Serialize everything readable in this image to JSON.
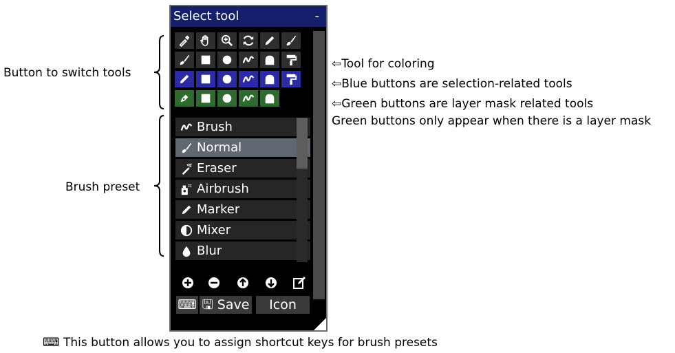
{
  "panel": {
    "title": "Select tool",
    "minimize": "-"
  },
  "annotations": {
    "switch_tools": "Button to switch tools",
    "brush_preset": "Brush preset",
    "coloring": "Tool for coloring",
    "blue": "Blue buttons are selection-related tools",
    "green": "Green buttons are layer mask related tools",
    "green_note": "Green buttons only appear when there is a layer mask",
    "shortcut": "This button allows you to assign shortcut keys for brush presets"
  },
  "presets": {
    "header": "Brush",
    "items": [
      "Normal",
      "Eraser",
      "Airbrush",
      "Marker",
      "Mixer",
      "Blur"
    ],
    "selected": "Normal"
  },
  "buttons": {
    "save": "Save",
    "icon": "Icon"
  },
  "icons": {
    "row1": [
      "eyedropper-icon",
      "hand-icon",
      "zoom-icon",
      "rotate-icon",
      "pencil-icon",
      "brush-icon"
    ],
    "row2": [
      "brush-icon",
      "rect-icon",
      "circle-icon",
      "freehand-icon",
      "shape-icon",
      "fill-roller-icon"
    ],
    "row3": [
      "pen-icon",
      "rect-icon",
      "circle-icon",
      "freehand-icon",
      "shape-icon",
      "fill-roller-icon"
    ],
    "row4": [
      "pen-icon",
      "rect-icon",
      "circle-icon",
      "freehand-icon",
      "shape-icon"
    ]
  },
  "colors": {
    "title_bg": "#14206b",
    "blue_btn": "#2b2ba6",
    "green_btn": "#2f6a2f",
    "selected_preset": "#616770"
  }
}
